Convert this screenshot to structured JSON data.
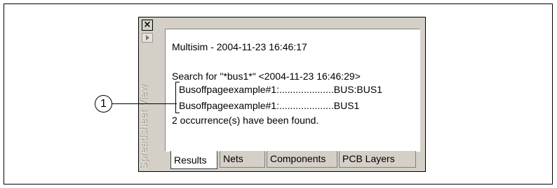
{
  "panel": {
    "close_glyph": "×",
    "sidebar_title": "Spreadsheet View"
  },
  "results": {
    "lines": [
      "Multisim  -  2004-11-23 16:46:17",
      "Search for  \"*bus1*\"  <2004-11-23 16:46:29>",
      "Busoffpageexample#1:....................BUS:BUS1",
      "Busoffpageexample#1:....................BUS1",
      "2 occurrence(s) have been found."
    ]
  },
  "tabs": [
    {
      "label": "Results",
      "active": true
    },
    {
      "label": "Nets",
      "active": false
    },
    {
      "label": "Components",
      "active": false
    },
    {
      "label": "PCB Layers",
      "active": false
    }
  ],
  "callout": {
    "number": "1"
  }
}
